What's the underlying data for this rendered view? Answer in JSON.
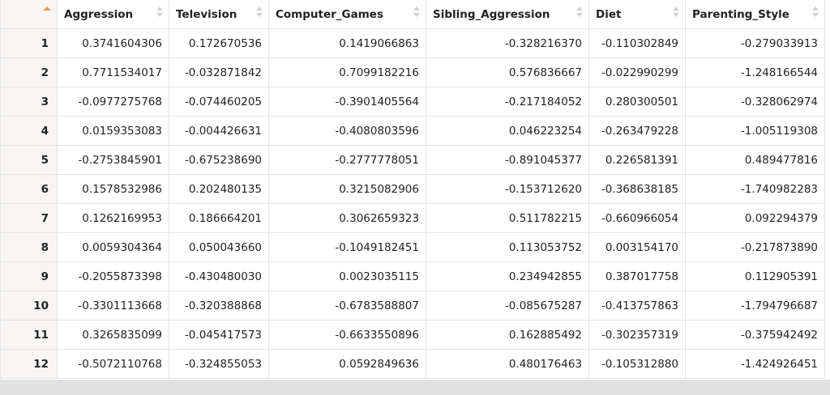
{
  "columns": [
    "Aggression",
    "Television",
    "Computer_Games",
    "Sibling_Aggression",
    "Diet",
    "Parenting_Style"
  ],
  "rows": [
    {
      "id": "1",
      "values": [
        "0.3741604306",
        "0.172670536",
        "0.1419066863",
        "-0.328216370",
        "-0.110302849",
        "-0.279033913"
      ]
    },
    {
      "id": "2",
      "values": [
        "0.7711534017",
        "-0.032871842",
        "0.7099182216",
        "0.576836667",
        "-0.022990299",
        "-1.248166544"
      ]
    },
    {
      "id": "3",
      "values": [
        "-0.0977275768",
        "-0.074460205",
        "-0.3901405564",
        "-0.217184052",
        "0.280300501",
        "-0.328062974"
      ]
    },
    {
      "id": "4",
      "values": [
        "0.0159353083",
        "-0.004426631",
        "-0.4080803596",
        "0.046223254",
        "-0.263479228",
        "-1.005119308"
      ]
    },
    {
      "id": "5",
      "values": [
        "-0.2753845901",
        "-0.675238690",
        "-0.2777778051",
        "-0.891045377",
        "0.226581391",
        "0.489477816"
      ]
    },
    {
      "id": "6",
      "values": [
        "0.1578532986",
        "0.202480135",
        "0.3215082906",
        "-0.153712620",
        "-0.368638185",
        "-1.740982283"
      ]
    },
    {
      "id": "7",
      "values": [
        "0.1262169953",
        "0.186664201",
        "0.3062659323",
        "0.511782215",
        "-0.660966054",
        "0.092294379"
      ]
    },
    {
      "id": "8",
      "values": [
        "0.0059304364",
        "0.050043660",
        "-0.1049182451",
        "0.113053752",
        "0.003154170",
        "-0.217873890"
      ]
    },
    {
      "id": "9",
      "values": [
        "-0.2055873398",
        "-0.430480030",
        "0.0023035115",
        "0.234942855",
        "0.387017758",
        "0.112905391"
      ]
    },
    {
      "id": "10",
      "values": [
        "-0.3301113668",
        "-0.320388868",
        "-0.6783588807",
        "-0.085675287",
        "-0.413757863",
        "-1.794796687"
      ]
    },
    {
      "id": "11",
      "values": [
        "0.3265835099",
        "-0.045417573",
        "-0.6633550896",
        "0.162885492",
        "-0.302357319",
        "-0.375942492"
      ]
    },
    {
      "id": "12",
      "values": [
        "-0.5072110768",
        "-0.324855053",
        "0.0592849636",
        "0.480176463",
        "-0.105312880",
        "-1.424926451"
      ]
    }
  ],
  "colors": {
    "sort_active": "#e89b4c",
    "row_header_bg": "#f7f6f4",
    "scrollbar": "#e2e2e2"
  }
}
